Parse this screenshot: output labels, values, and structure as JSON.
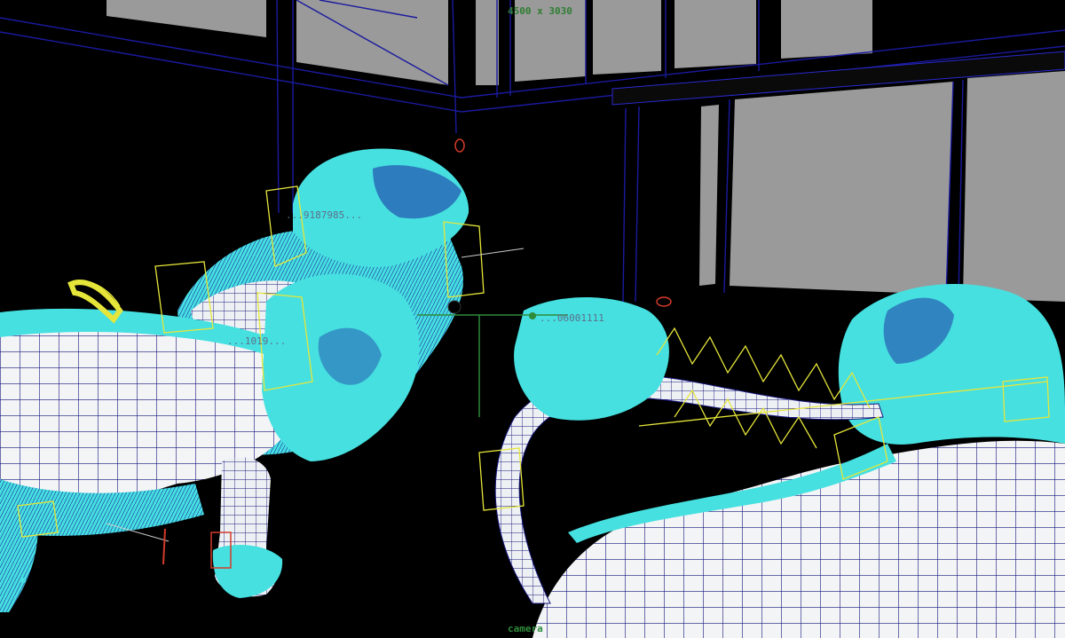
{
  "viewport": {
    "resolution_gate": "4500 x 3030",
    "camera_label": "camera",
    "node_labels": [
      "...9187985...",
      "...1019...",
      "...06001111"
    ],
    "control_marker": "C"
  },
  "colors": {
    "background": "#000000",
    "wall_gray": "#9a9a9a",
    "set_wire": "#1a1a9e",
    "fur": "#46e0e0",
    "mesh_white": "#f2f4f6",
    "mesh_wire": "#16167a",
    "control_curves": "#e6e63a",
    "hud_text": "#2e7d32",
    "nodes_red": "#d23a2a"
  },
  "icons": [
    "resolution-gate-overlay",
    "locator-icon",
    "pivot-manipulator-icon"
  ]
}
